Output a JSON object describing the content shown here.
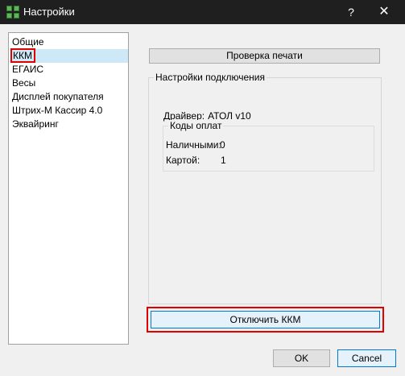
{
  "window": {
    "title": "Настройки",
    "help_glyph": "?",
    "close_glyph": "✕"
  },
  "sidebar": {
    "items": [
      {
        "label": "Общие"
      },
      {
        "label": "ККМ"
      },
      {
        "label": "ЕГАИС"
      },
      {
        "label": "Весы"
      },
      {
        "label": "Дисплей покупателя"
      },
      {
        "label": "Штрих-М Кассир 4.0"
      },
      {
        "label": "Эквайринг"
      }
    ],
    "selected": "ККМ"
  },
  "kkm": {
    "print_check_label": "Проверка печати",
    "connection_group_title": "Настройки подключения",
    "driver_label": "Драйвер:",
    "driver_value": "АТОЛ v10",
    "payment_codes": {
      "title": "Коды оплат",
      "cash_label": "Наличными:",
      "cash_value": "0",
      "card_label": "Картой:",
      "card_value": "1"
    },
    "disable_label": "Отключить ККМ"
  },
  "footer": {
    "ok_label": "OK",
    "cancel_label": "Cancel"
  },
  "colors": {
    "titlebar": "#1f1f1f",
    "highlight_red": "#e00000",
    "selection": "#cde8f7",
    "focus_blue": "#0078d7"
  }
}
